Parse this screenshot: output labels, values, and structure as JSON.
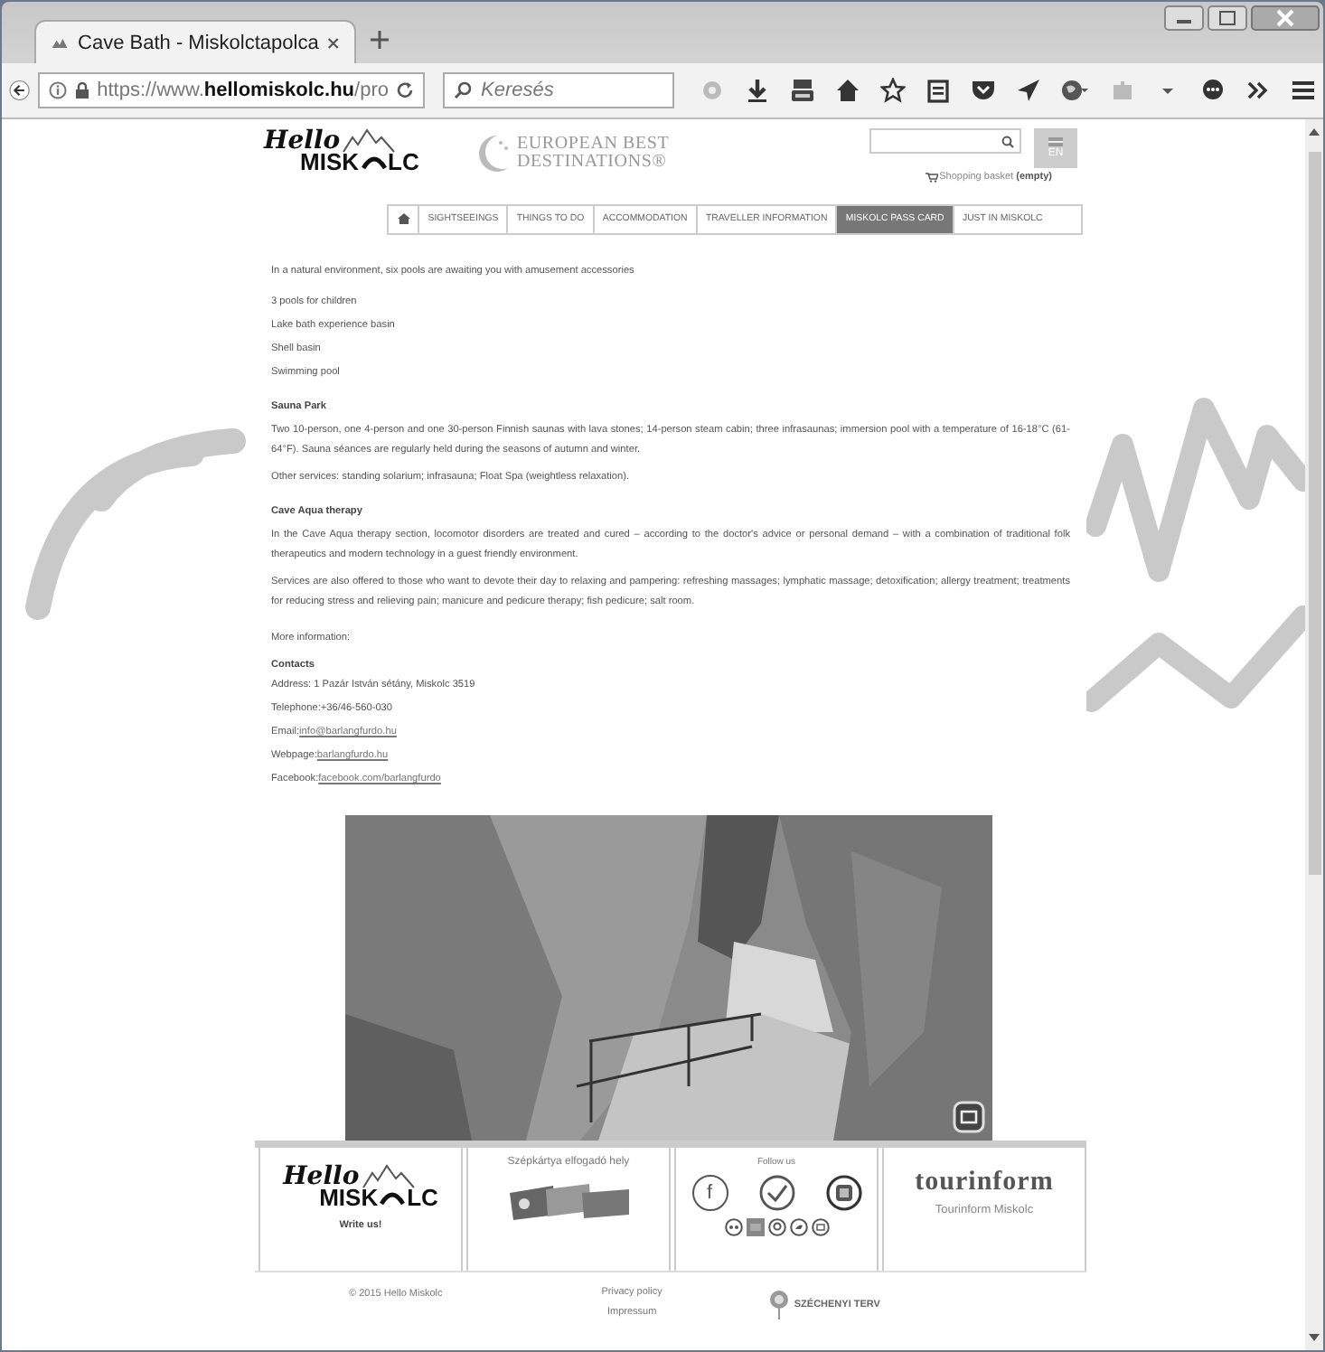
{
  "browser": {
    "tab_title": "Cave Bath - Miskolctapolca",
    "url": "https://www.**hellomiskolc.hu**/pro",
    "search_placeholder": "Keresés"
  },
  "header": {
    "logo_script": "Hello",
    "logo_left": "MISK",
    "logo_right": "LC",
    "ebd_line1": "EUROPEAN BEST",
    "ebd_line2": "DESTINATIONS®",
    "language": "EN",
    "basket": "Shopping basket **(empty)**"
  },
  "nav": [
    {
      "kind": "icon",
      "selected": false
    },
    {
      "kind": "text",
      "label": "SIGHTSEEINGS",
      "selected": false
    },
    {
      "kind": "text",
      "label": "THINGS TO DO",
      "selected": false
    },
    {
      "kind": "text",
      "label": "ACCOMMODATION",
      "selected": false
    },
    {
      "kind": "text",
      "label": "TRAVELLER INFORMATION",
      "selected": false
    },
    {
      "kind": "text",
      "label": "MISKOLC PASS CARD",
      "selected": true
    },
    {
      "kind": "text",
      "label": "JUST IN MISKOLC",
      "selected": false
    }
  ],
  "content": [
    {
      "kind": "text",
      "text": "In a natural environment, six pools are awaiting you with amusement accessories"
    },
    {
      "kind": "list",
      "items": [
        "3 pools for children",
        "Lake bath experience basin",
        "Shell basin",
        "Swimming pool"
      ]
    },
    {
      "kind": "heading",
      "text": "Sauna Park"
    },
    {
      "kind": "text",
      "text": "Two 10-person, one 4-person and one 30-person Finnish saunas with lava stones; 14-person steam cabin; three infrasaunas; immersion pool with a temperature of 16-18°C (61-64°F). Sauna séances are regularly held during the seasons of autumn and winter."
    },
    {
      "kind": "text",
      "text": "Other services: standing solarium; infrasauna; Float Spa (weightless relaxation)."
    },
    {
      "kind": "heading",
      "text": "Cave Aqua therapy"
    },
    {
      "kind": "text",
      "text": "In the Cave Aqua therapy section, locomotor disorders are treated and cured – according to the doctor's advice or personal demand – with a combination of traditional folk therapeutics and modern technology in a guest friendly environment."
    },
    {
      "kind": "text",
      "text": "Services are also offered to those who want to devote their day to relaxing and pampering: refreshing massages; lymphatic massage; detoxification; allergy treatment; treatments for reducing stress and relieving pain; manicure and pedicure therapy; fish pedicure; salt room."
    },
    {
      "kind": "gap_text",
      "text": "More information:"
    },
    {
      "kind": "heading",
      "text": "Contacts"
    },
    {
      "kind": "line",
      "text": "Address: 1 Pazár István sétány, Miskolc 3519"
    },
    {
      "kind": "line",
      "text": "Telephone:+36/46-560-030"
    },
    {
      "kind": "contact",
      "label": "Email:",
      "link": "info@barlangfurdo.hu"
    },
    {
      "kind": "contact",
      "label": "Webpage:",
      "link": "barlangfurdo.hu"
    },
    {
      "kind": "contact",
      "label": "Facebook:",
      "link": "facebook.com/barlangfurdo"
    }
  ],
  "footer": {
    "logo_script": "Hello",
    "logo_left": "MISK",
    "logo_right": "LC",
    "write_us": "Write us!",
    "szep_title": "Szépkártya elfogadó hely",
    "follow_title": "Follow us",
    "facebook_glyph": "f",
    "tourinform_logo": "tourinform",
    "tourinform_name": "Tourinform Miskolc"
  },
  "bottom": {
    "copyright": "© 2015 Hello Miskolc",
    "links": [
      "Privacy policy",
      "Impressum"
    ],
    "szechenyi": "SZÉCHENYI TERV"
  }
}
